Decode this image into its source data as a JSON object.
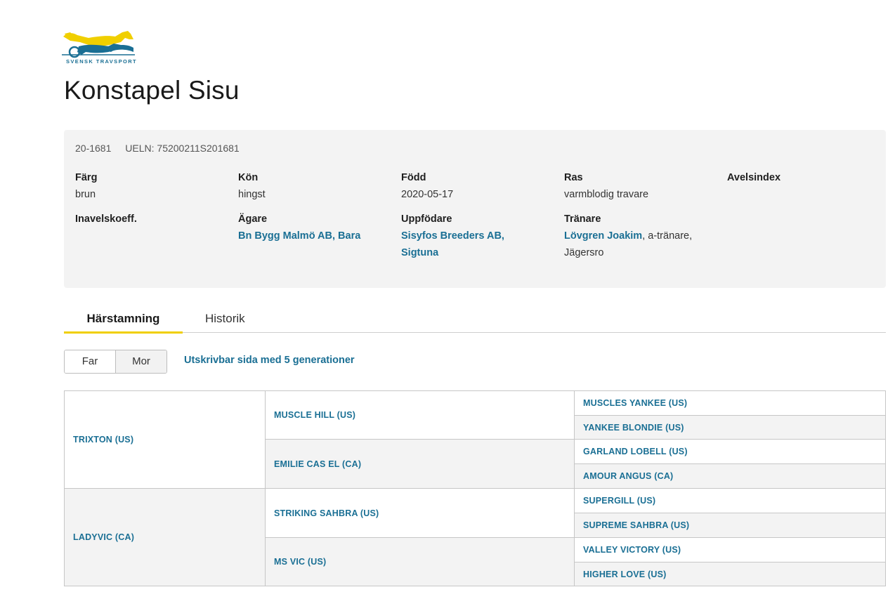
{
  "brand": {
    "logo_text": "SVENSK TRAVSPORT",
    "colors": {
      "yellow": "#f0cf00",
      "blue": "#1a6f94"
    }
  },
  "horse": {
    "name": "Konstapel Sisu",
    "reg_number": "20-1681",
    "ueln": "UELN: 75200211S201681"
  },
  "info": {
    "color": {
      "label": "Färg",
      "value": "brun"
    },
    "sex": {
      "label": "Kön",
      "value": "hingst"
    },
    "born": {
      "label": "Född",
      "value": "2020-05-17"
    },
    "breed": {
      "label": "Ras",
      "value": "varmblodig travare"
    },
    "breeding_index": {
      "label": "Avelsindex"
    },
    "inbreeding": {
      "label": "Inavelskoeff."
    },
    "owner": {
      "label": "Ägare",
      "link": "Bn Bygg Malmö AB, Bara"
    },
    "breeder": {
      "label": "Uppfödare",
      "link_line1": "Sisyfos Breeders AB,",
      "link_line2": "Sigtuna"
    },
    "trainer": {
      "label": "Tränare",
      "link": "Lövgren Joakim",
      "rest_line1": ", a-tränare,",
      "line2": "Jägersro"
    }
  },
  "tabs": [
    {
      "label": "Härstamning",
      "active": true
    },
    {
      "label": "Historik",
      "active": false
    }
  ],
  "segment": {
    "far": "Far",
    "mor": "Mor"
  },
  "print_link": "Utskrivbar sida med 5 generationer",
  "pedigree": {
    "gen1": [
      "TRIXTON (US)",
      "LADYVIC (CA)"
    ],
    "gen2": [
      "MUSCLE HILL (US)",
      "EMILIE CAS EL (CA)",
      "STRIKING SAHBRA (US)",
      "MS VIC (US)"
    ],
    "gen3": [
      "MUSCLES YANKEE (US)",
      "YANKEE BLONDIE (US)",
      "GARLAND LOBELL (US)",
      "AMOUR ANGUS (CA)",
      "SUPERGILL (US)",
      "SUPREME SAHBRA (US)",
      "VALLEY VICTORY (US)",
      "HIGHER LOVE (US)"
    ]
  }
}
